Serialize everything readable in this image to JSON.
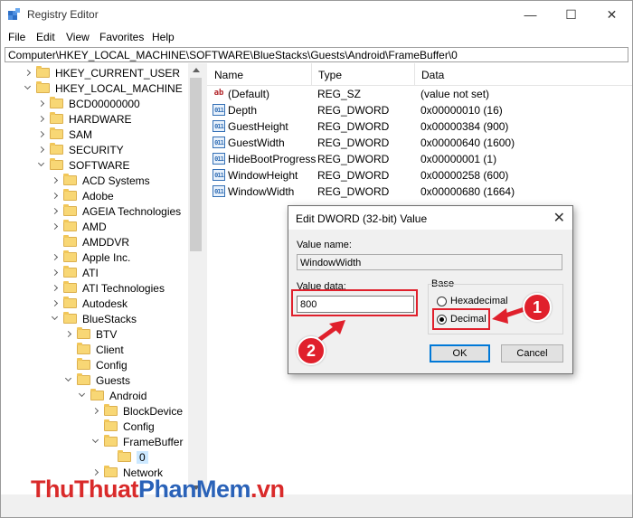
{
  "window": {
    "title": "Registry Editor",
    "minimize_glyph": "—",
    "maximize_glyph": "☐",
    "close_glyph": "✕"
  },
  "menu": [
    "File",
    "Edit",
    "View",
    "Favorites",
    "Help"
  ],
  "address": "Computer\\HKEY_LOCAL_MACHINE\\SOFTWARE\\BlueStacks\\Guests\\Android\\FrameBuffer\\0",
  "tree": [
    {
      "label": "HKEY_CURRENT_USER",
      "expander": "right",
      "depth": 0
    },
    {
      "label": "HKEY_LOCAL_MACHINE",
      "expander": "down",
      "depth": 0
    },
    {
      "label": "BCD00000000",
      "expander": "right",
      "depth": 1
    },
    {
      "label": "HARDWARE",
      "expander": "right",
      "depth": 1
    },
    {
      "label": "SAM",
      "expander": "right",
      "depth": 1
    },
    {
      "label": "SECURITY",
      "expander": "right",
      "depth": 1
    },
    {
      "label": "SOFTWARE",
      "expander": "down",
      "depth": 1
    },
    {
      "label": "ACD Systems",
      "expander": "right",
      "depth": 2
    },
    {
      "label": "Adobe",
      "expander": "right",
      "depth": 2
    },
    {
      "label": "AGEIA Technologies",
      "expander": "right",
      "depth": 2
    },
    {
      "label": "AMD",
      "expander": "right",
      "depth": 2
    },
    {
      "label": "AMDDVR",
      "expander": "none",
      "depth": 2
    },
    {
      "label": "Apple Inc.",
      "expander": "right",
      "depth": 2
    },
    {
      "label": "ATI",
      "expander": "right",
      "depth": 2
    },
    {
      "label": "ATI Technologies",
      "expander": "right",
      "depth": 2
    },
    {
      "label": "Autodesk",
      "expander": "right",
      "depth": 2
    },
    {
      "label": "BlueStacks",
      "expander": "down",
      "depth": 2
    },
    {
      "label": "BTV",
      "expander": "right",
      "depth": 3
    },
    {
      "label": "Client",
      "expander": "none",
      "depth": 3
    },
    {
      "label": "Config",
      "expander": "none",
      "depth": 3
    },
    {
      "label": "Guests",
      "expander": "down",
      "depth": 3
    },
    {
      "label": "Android",
      "expander": "down",
      "depth": 4
    },
    {
      "label": "BlockDevice",
      "expander": "right",
      "depth": 5
    },
    {
      "label": "Config",
      "expander": "none",
      "depth": 5
    },
    {
      "label": "FrameBuffer",
      "expander": "down",
      "depth": 5
    },
    {
      "label": "0",
      "expander": "none",
      "depth": 6,
      "selected": true
    },
    {
      "label": "Network",
      "expander": "right",
      "depth": 5
    }
  ],
  "list": {
    "headers": {
      "name": "Name",
      "type": "Type",
      "data": "Data"
    },
    "rows": [
      {
        "icon": "string-value-icon",
        "glyph": "ab",
        "name": "(Default)",
        "type": "REG_SZ",
        "data": "(value not set)"
      },
      {
        "icon": "dword-value-icon",
        "glyph": "011",
        "name": "Depth",
        "type": "REG_DWORD",
        "data": "0x00000010 (16)"
      },
      {
        "icon": "dword-value-icon",
        "glyph": "011",
        "name": "GuestHeight",
        "type": "REG_DWORD",
        "data": "0x00000384 (900)"
      },
      {
        "icon": "dword-value-icon",
        "glyph": "011",
        "name": "GuestWidth",
        "type": "REG_DWORD",
        "data": "0x00000640 (1600)"
      },
      {
        "icon": "dword-value-icon",
        "glyph": "011",
        "name": "HideBootProgress",
        "type": "REG_DWORD",
        "data": "0x00000001 (1)"
      },
      {
        "icon": "dword-value-icon",
        "glyph": "011",
        "name": "WindowHeight",
        "type": "REG_DWORD",
        "data": "0x00000258 (600)"
      },
      {
        "icon": "dword-value-icon",
        "glyph": "011",
        "name": "WindowWidth",
        "type": "REG_DWORD",
        "data": "0x00000680 (1664)"
      }
    ]
  },
  "dialog": {
    "title": "Edit DWORD (32-bit) Value",
    "close_glyph": "✕",
    "value_name_label": "Value name:",
    "value_name": "WindowWidth",
    "value_data_label": "Value data:",
    "value_data": "800",
    "base_label": "Base",
    "hex_label": "Hexadecimal",
    "dec_label": "Decimal",
    "selected_base": "Decimal",
    "ok_label": "OK",
    "cancel_label": "Cancel"
  },
  "annotations": {
    "badge1": "1",
    "badge2": "2",
    "highlight_color": "#e0202c"
  },
  "watermark": {
    "part1": "ThuThuat",
    "part2": "PhanMem",
    "part3": ".vn"
  }
}
